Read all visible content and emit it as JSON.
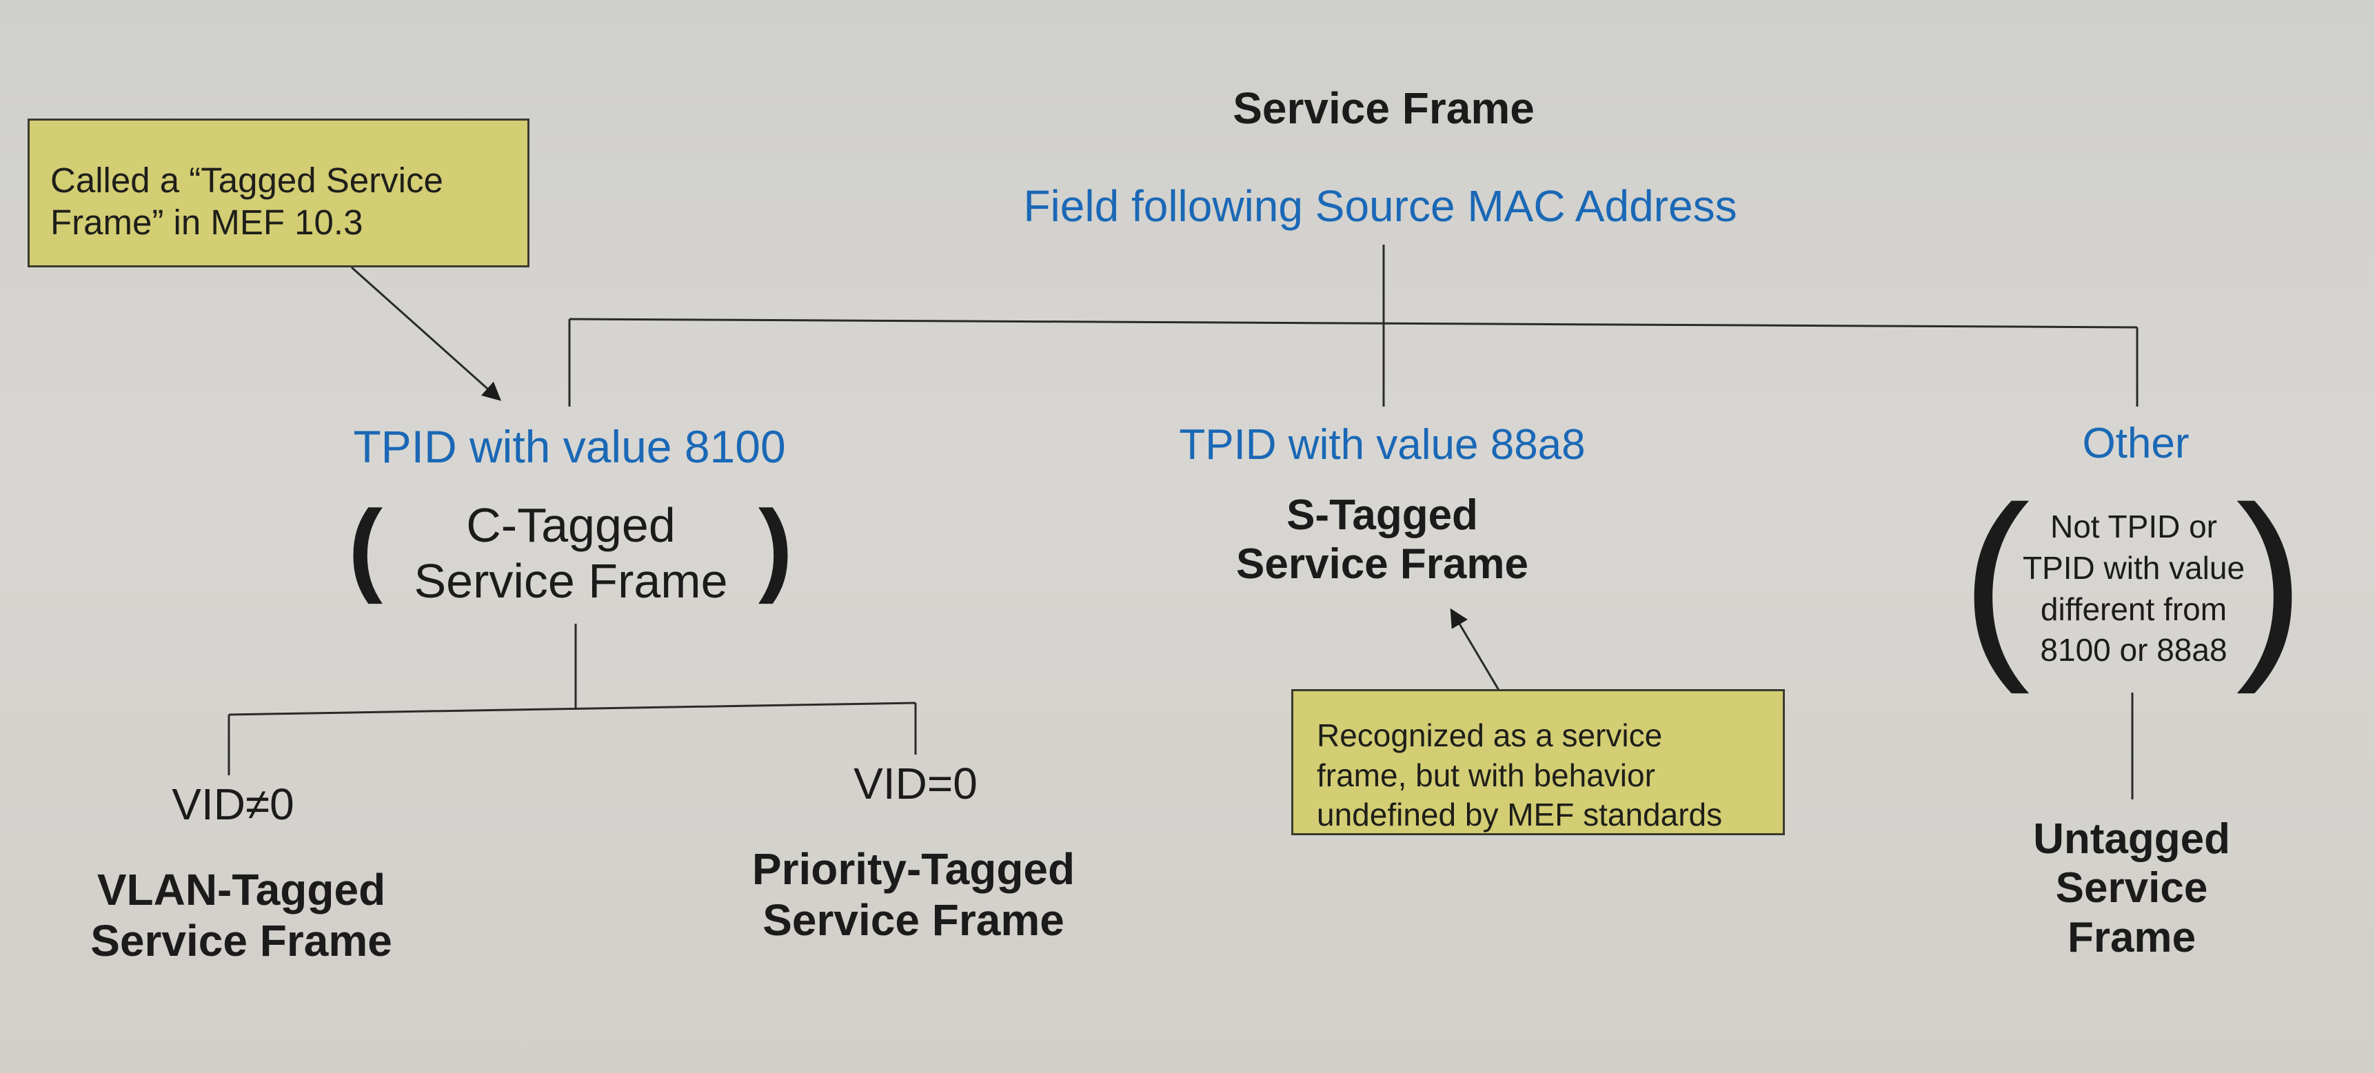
{
  "root": {
    "title": "Service Frame",
    "subtitle": "Field following Source MAC Address"
  },
  "branches": {
    "c_tag": {
      "label": "TPID with value 8100",
      "frame": "C-Tagged\nService Frame",
      "sub": {
        "vlan": {
          "condition": "VID≠0",
          "frame": "VLAN-Tagged\nService Frame"
        },
        "priority": {
          "condition": "VID=0",
          "frame": "Priority-Tagged\nService Frame"
        }
      }
    },
    "s_tag": {
      "label": "TPID with value 88a8",
      "frame": "S-Tagged\nService Frame"
    },
    "other": {
      "label": "Other",
      "condition": "Not TPID or\nTPID with value\ndifferent from\n8100 or 88a8",
      "frame": "Untagged\nService Frame"
    }
  },
  "notes": {
    "tagged": "Called a “Tagged Service\nFrame” in MEF 10.3",
    "s_tag": "Recognized as a service\nframe, but with behavior\nundefined by MEF standards"
  },
  "colors": {
    "branch_label": "#1a68b6",
    "note_fill": "#d3cd74",
    "text": "#1b1b1b"
  }
}
